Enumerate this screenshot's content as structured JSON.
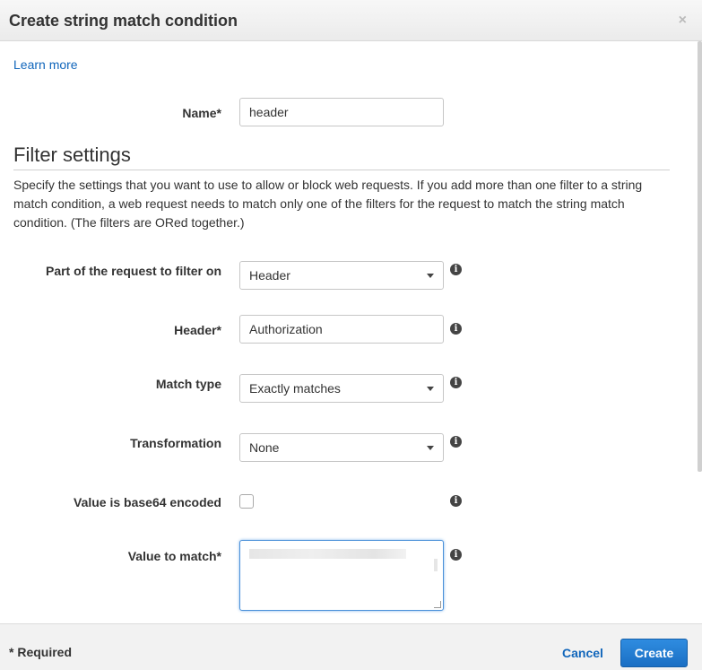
{
  "dialog": {
    "title": "Create string match condition",
    "close_glyph": "×"
  },
  "intro": {
    "learn_more": "Learn more"
  },
  "name_field": {
    "label": "Name*",
    "value": "header"
  },
  "filter_settings": {
    "title": "Filter settings",
    "description": "Specify the settings that you want to use to allow or block web requests. If you add more than one filter to a string match condition, a web request needs to match only one of the filters for the request to match the string match condition. (The filters are ORed together.)"
  },
  "fields": {
    "part": {
      "label": "Part of the request to filter on",
      "value": "Header"
    },
    "header": {
      "label": "Header*",
      "value": "Authorization"
    },
    "match_type": {
      "label": "Match type",
      "value": "Exactly matches"
    },
    "transformation": {
      "label": "Transformation",
      "value": "None"
    },
    "base64": {
      "label": "Value is base64 encoded",
      "checked": false
    },
    "value_to_match": {
      "label": "Value to match*"
    }
  },
  "icons": {
    "info": "info-icon",
    "caret": "chevron-down-icon"
  },
  "footer": {
    "required_note": "* Required",
    "cancel_label": "Cancel",
    "create_label": "Create"
  },
  "colors": {
    "link": "#1166bb",
    "primary_button": "#1a6fc4",
    "focus_border": "#4a90d9"
  }
}
